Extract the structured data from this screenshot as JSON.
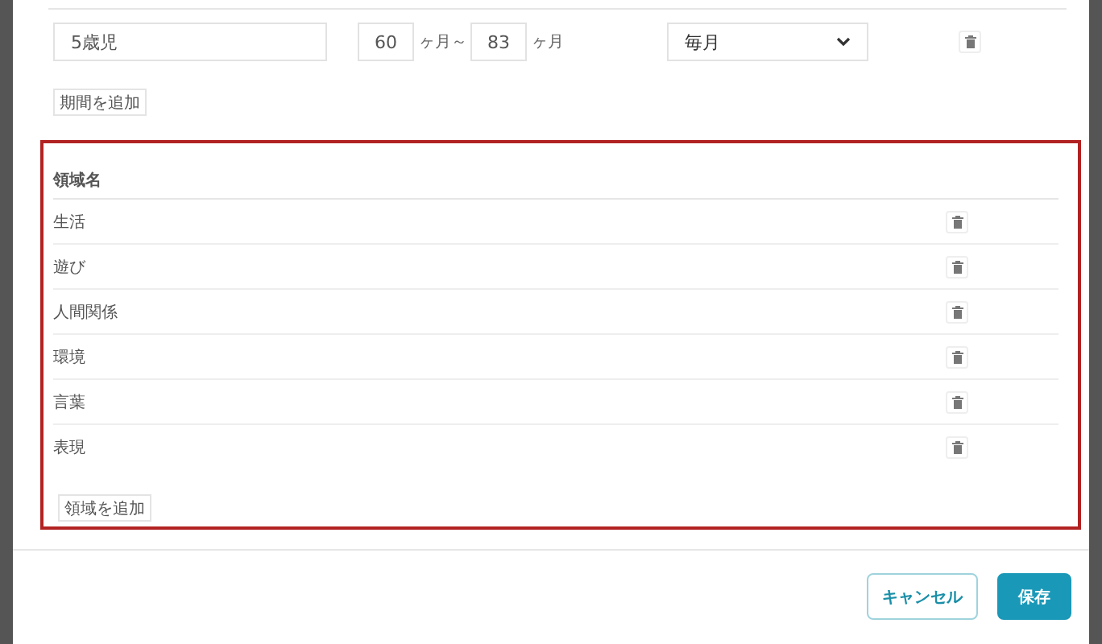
{
  "period": {
    "name": "5歳児",
    "from": "60",
    "from_unit": "ヶ月～",
    "to": "83",
    "to_unit": "ヶ月",
    "frequency": "毎月"
  },
  "add_period_button": "期間を追加",
  "domains": {
    "header": "領域名",
    "rows": [
      {
        "name": "生活"
      },
      {
        "name": "遊び"
      },
      {
        "name": "人間関係"
      },
      {
        "name": "環境"
      },
      {
        "name": "言葉"
      },
      {
        "name": "表現"
      }
    ],
    "add_button": "領域を追加"
  },
  "footer": {
    "cancel": "キャンセル",
    "save": "保存"
  }
}
